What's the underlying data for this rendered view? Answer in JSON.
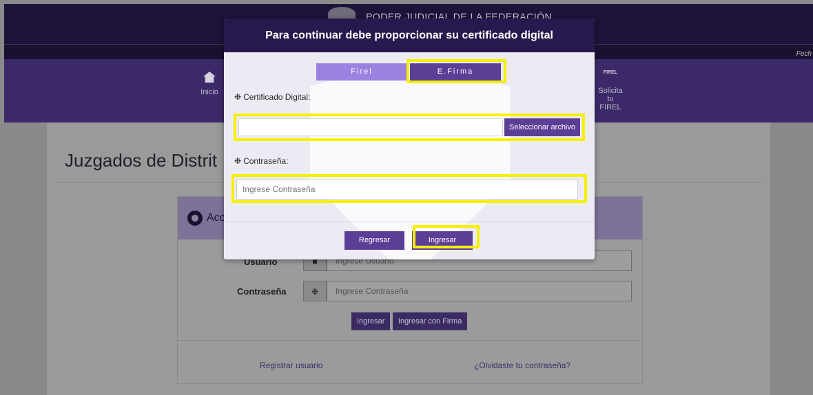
{
  "header": {
    "brand": "PODER JUDICIAL DE LA FEDERACIÓN",
    "date_label": "Fech"
  },
  "nav": {
    "items": [
      {
        "label": "Inicio",
        "icon": "home-icon"
      },
      {
        "label": "Solicita tu FIREL",
        "icon": "firel-icon"
      }
    ]
  },
  "page": {
    "title": "Juzgados de Distrit",
    "card_title": "Acc",
    "user_label": "Usuario",
    "user_placeholder": "Ingrese Usuario",
    "password_label": "Contraseña",
    "password_placeholder": "Ingrese Contraseña",
    "login_button": "Ingresar",
    "login_signature_button": "Ingresar con Firma",
    "register_link": "Registrar usuario",
    "forgot_link": "¿Olvidaste tu contraseña?"
  },
  "modal": {
    "title": "Para continuar debe proporcionar su certificado digital",
    "tabs": [
      {
        "label": "Firel",
        "active": true
      },
      {
        "label": "E.Firma",
        "active": false
      }
    ],
    "certificate_label": "Certificado Digital:",
    "file_button": "Seleccionar archivo",
    "password_label": "Contraseña:",
    "password_placeholder": "Ingrese Contraseña",
    "back_button": "Regresar",
    "submit_button": "Ingresar",
    "firel_icon_text": "FIREL"
  },
  "colors": {
    "highlight": "#f6f000",
    "modal_header": "#27194d",
    "accent": "#5d3e96",
    "tab_active": "#9b82e0"
  }
}
